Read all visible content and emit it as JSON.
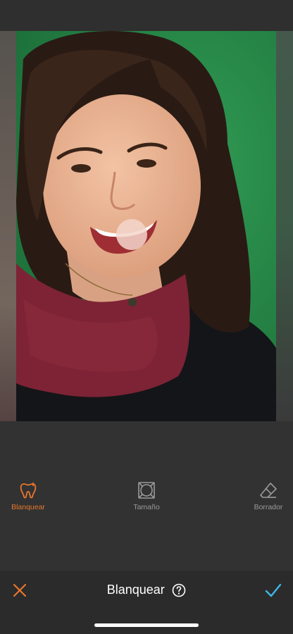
{
  "tools": [
    {
      "label": "Blanquear",
      "icon": "tooth-icon",
      "active": true
    },
    {
      "label": "Tamaño",
      "icon": "resize-circle-icon",
      "active": false
    },
    {
      "label": "Borrador",
      "icon": "eraser-icon",
      "active": false
    }
  ],
  "bottom_bar": {
    "title": "Blanquear",
    "help_icon": "question-circle-icon",
    "cancel_icon": "close-icon",
    "confirm_icon": "checkmark-icon"
  },
  "colors": {
    "accent": "#e8762c",
    "confirm": "#3fb6e6",
    "inactive_label": "#9a9a9a",
    "background": "#323232"
  }
}
